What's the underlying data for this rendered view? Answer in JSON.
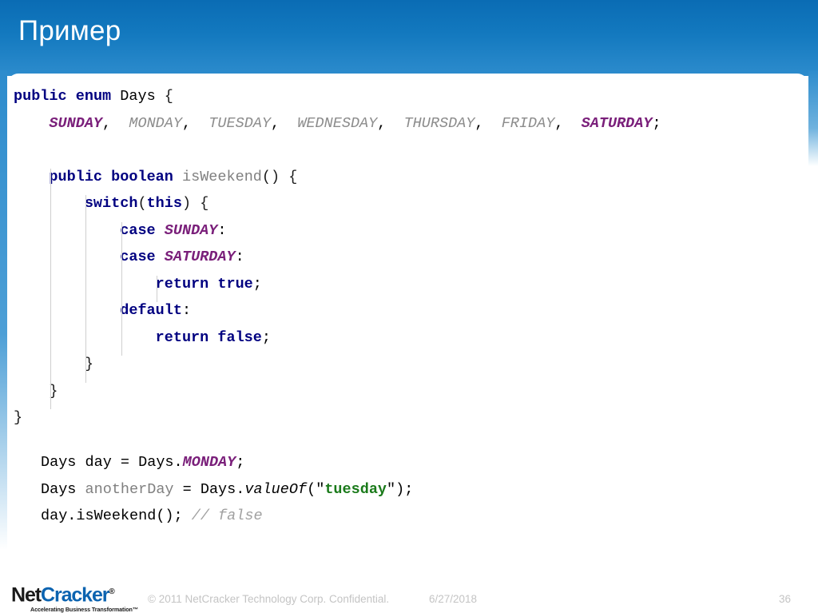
{
  "slide": {
    "title": "Пример",
    "header_color_top": "#0a6cb4",
    "header_color_bottom": "#2d8ccd"
  },
  "code": {
    "language": "java",
    "lines": [
      {
        "tokens": [
          {
            "text": "public",
            "style": "kw"
          },
          {
            "text": " ",
            "style": "plain"
          },
          {
            "text": "enum",
            "style": "kw"
          },
          {
            "text": " ",
            "style": "plain"
          },
          {
            "text": "Days",
            "style": "plain"
          },
          {
            "text": " {",
            "style": "brace"
          }
        ]
      },
      {
        "indent": 4,
        "tokens": [
          {
            "text": "SUNDAY",
            "style": "enumc"
          },
          {
            "text": ",  ",
            "style": "plain"
          },
          {
            "text": "MONDAY",
            "style": "enumc-d"
          },
          {
            "text": ",  ",
            "style": "plain"
          },
          {
            "text": "TUESDAY",
            "style": "enumc-d"
          },
          {
            "text": ",  ",
            "style": "plain"
          },
          {
            "text": "WEDNESDAY",
            "style": "enumc-d"
          },
          {
            "text": ",  ",
            "style": "plain"
          },
          {
            "text": "THURSDAY",
            "style": "enumc-d"
          },
          {
            "text": ",  ",
            "style": "plain"
          },
          {
            "text": "FRIDAY",
            "style": "enumc-d"
          },
          {
            "text": ",  ",
            "style": "plain"
          },
          {
            "text": "SATURDAY",
            "style": "enumc"
          },
          {
            "text": ";",
            "style": "plain"
          }
        ]
      },
      {
        "tokens": []
      },
      {
        "indent": 4,
        "tokens": [
          {
            "text": "public",
            "style": "kw"
          },
          {
            "text": " ",
            "style": "plain"
          },
          {
            "text": "boolean",
            "style": "kw"
          },
          {
            "text": " ",
            "style": "plain"
          },
          {
            "text": "isWeekend",
            "style": "ident"
          },
          {
            "text": "() {",
            "style": "brace"
          }
        ]
      },
      {
        "indent": 8,
        "tokens": [
          {
            "text": "switch",
            "style": "kw"
          },
          {
            "text": "(",
            "style": "brace"
          },
          {
            "text": "this",
            "style": "kw"
          },
          {
            "text": ") {",
            "style": "brace"
          }
        ]
      },
      {
        "indent": 12,
        "tokens": [
          {
            "text": "case",
            "style": "kw"
          },
          {
            "text": " ",
            "style": "plain"
          },
          {
            "text": "SUNDAY",
            "style": "enumc"
          },
          {
            "text": ":",
            "style": "plain"
          }
        ]
      },
      {
        "indent": 12,
        "tokens": [
          {
            "text": "case",
            "style": "kw"
          },
          {
            "text": " ",
            "style": "plain"
          },
          {
            "text": "SATURDAY",
            "style": "enumc"
          },
          {
            "text": ":",
            "style": "plain"
          }
        ]
      },
      {
        "indent": 16,
        "tokens": [
          {
            "text": "return",
            "style": "kw"
          },
          {
            "text": " ",
            "style": "plain"
          },
          {
            "text": "true",
            "style": "kw"
          },
          {
            "text": ";",
            "style": "plain"
          }
        ]
      },
      {
        "indent": 12,
        "tokens": [
          {
            "text": "default",
            "style": "kw"
          },
          {
            "text": ":",
            "style": "plain"
          }
        ]
      },
      {
        "indent": 16,
        "tokens": [
          {
            "text": "return",
            "style": "kw"
          },
          {
            "text": " ",
            "style": "plain"
          },
          {
            "text": "false",
            "style": "kw"
          },
          {
            "text": ";",
            "style": "plain"
          }
        ]
      },
      {
        "indent": 8,
        "tokens": [
          {
            "text": "}",
            "style": "brace"
          }
        ]
      },
      {
        "indent": 4,
        "tokens": [
          {
            "text": "}",
            "style": "brace"
          }
        ]
      },
      {
        "indent": 0,
        "tokens": [
          {
            "text": "}",
            "style": "brace"
          }
        ]
      }
    ],
    "usage_lines": [
      {
        "tokens": [
          {
            "text": "Days day = Days.",
            "style": "plain"
          },
          {
            "text": "MONDAY",
            "style": "enumc"
          },
          {
            "text": ";",
            "style": "plain"
          }
        ]
      },
      {
        "tokens": [
          {
            "text": "Days ",
            "style": "plain"
          },
          {
            "text": "anotherDay",
            "style": "ident"
          },
          {
            "text": " = Days.",
            "style": "plain"
          },
          {
            "text": "valueOf",
            "style": "ital"
          },
          {
            "text": "(\"",
            "style": "plain"
          },
          {
            "text": "tuesday",
            "style": "str"
          },
          {
            "text": "\");",
            "style": "plain"
          }
        ]
      },
      {
        "tokens": [
          {
            "text": "day.isWeekend();",
            "style": "plain"
          },
          {
            "text": " ",
            "style": "plain"
          },
          {
            "text": "// false",
            "style": "cmt"
          }
        ]
      }
    ]
  },
  "footer": {
    "logo_net": "Net",
    "logo_cracker": "Cracker",
    "logo_registered": "®",
    "logo_tagline": "Accelerating Business Transformation™",
    "copyright": "© 2011 NetCracker Technology Corp. Confidential.",
    "date": "6/27/2018",
    "page_number": "36"
  }
}
